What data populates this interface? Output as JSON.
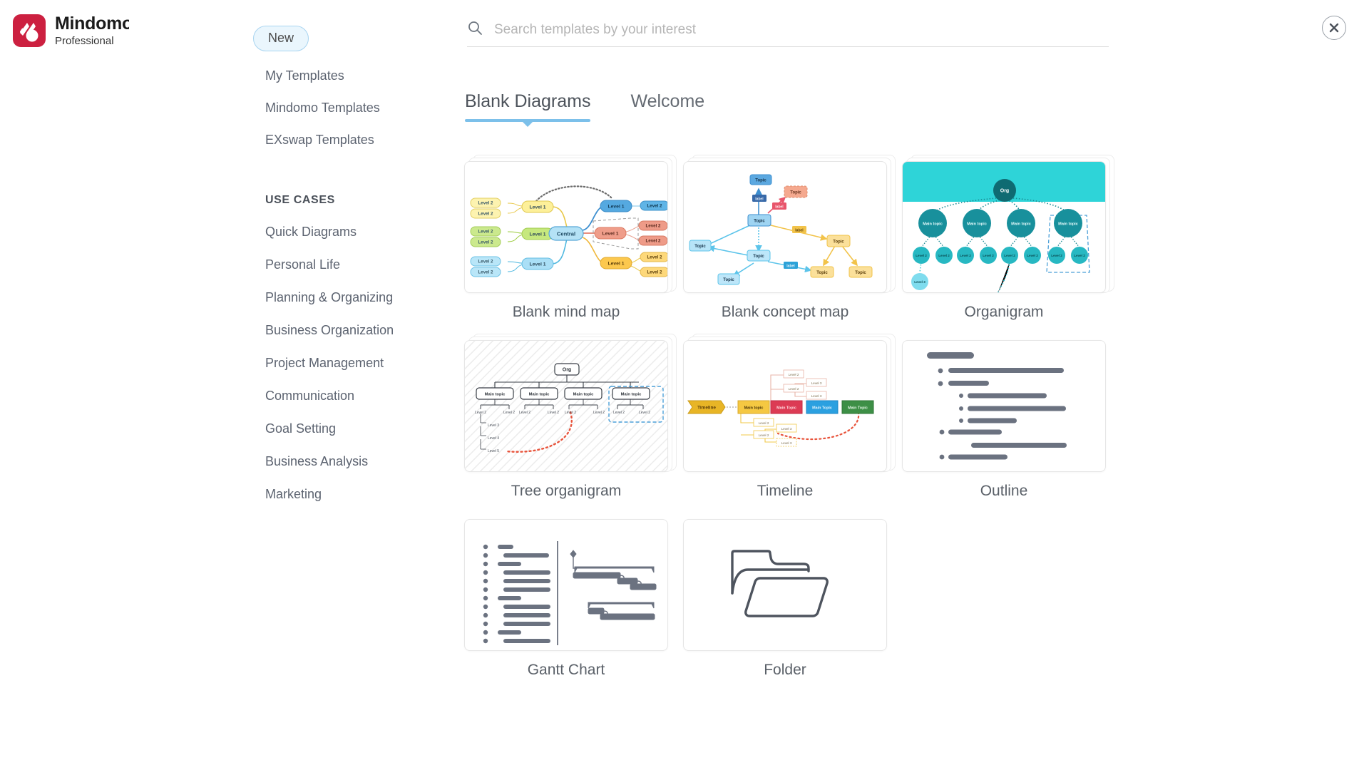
{
  "brand": {
    "name": "Mindomo",
    "plan": "Professional",
    "logo_color": "#cc2040"
  },
  "sidebar": {
    "new_label": "New",
    "nav": [
      {
        "label": "My Templates"
      },
      {
        "label": "Mindomo Templates"
      },
      {
        "label": "EXswap Templates"
      }
    ],
    "usecases_title": "USE CASES",
    "usecases": [
      {
        "label": "Quick Diagrams"
      },
      {
        "label": "Personal Life"
      },
      {
        "label": "Planning & Organizing"
      },
      {
        "label": "Business Organization"
      },
      {
        "label": "Project Management"
      },
      {
        "label": "Communication"
      },
      {
        "label": "Goal Setting"
      },
      {
        "label": "Business Analysis"
      },
      {
        "label": "Marketing"
      }
    ]
  },
  "search": {
    "placeholder": "Search templates by your interest",
    "value": ""
  },
  "tabs": [
    {
      "label": "Blank Diagrams",
      "active": true
    },
    {
      "label": "Welcome",
      "active": false
    }
  ],
  "templates": [
    {
      "label": "Blank mind map"
    },
    {
      "label": "Blank concept map"
    },
    {
      "label": "Organigram"
    },
    {
      "label": "Tree organigram"
    },
    {
      "label": "Timeline"
    },
    {
      "label": "Outline"
    },
    {
      "label": "Gantt Chart"
    },
    {
      "label": "Folder"
    }
  ],
  "thumbnail_text": {
    "central": "Central",
    "level1": "Level 1",
    "level2": "Level 2",
    "level3": "Level 3",
    "topic": "Topic",
    "label": "label",
    "org": "Org",
    "main_topic": "Main topic",
    "main_topic_caps": "Main Topic",
    "timeline": "Timeline"
  },
  "close": {
    "icon": "close-icon"
  },
  "colors": {
    "accent_blue": "#7cc0ea",
    "new_pill_bg": "#eaf6fd",
    "new_pill_border": "#a8d4f0",
    "teal": "#2bd4d4",
    "teal_dark": "#17707a",
    "yellow": "#fdf0a8",
    "green": "#c8e88a",
    "lightblue": "#b6e3f7",
    "salmon": "#f0a090",
    "gantt_gray": "#6b7280"
  }
}
